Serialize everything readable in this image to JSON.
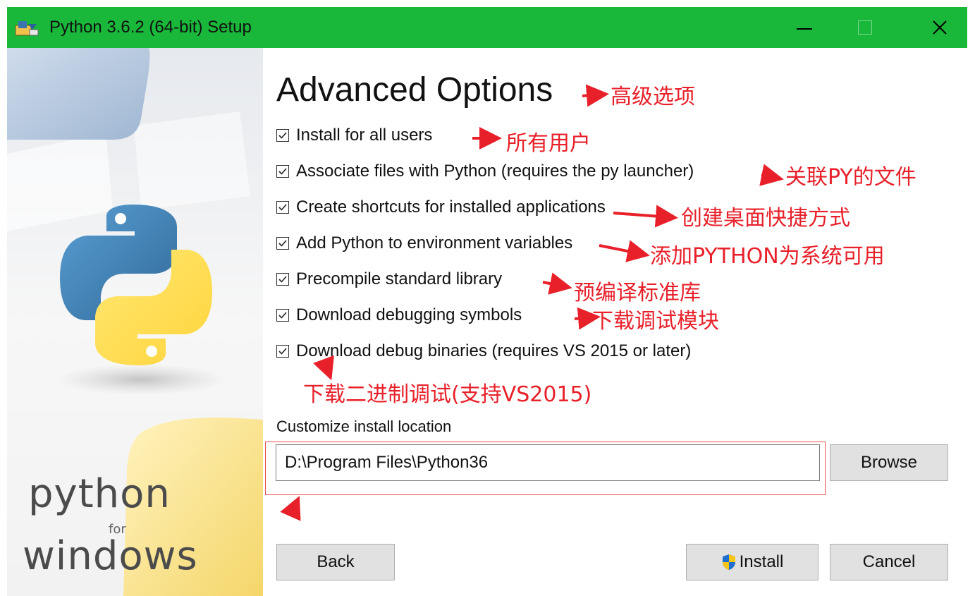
{
  "window": {
    "title": "Python 3.6.2 (64-bit) Setup",
    "app_icon": "python-setup-icon",
    "minimize_icon": "minimize-icon",
    "maximize_icon": "maximize-icon",
    "close_icon": "close-icon",
    "close_glyph": "✕",
    "titlebar_color": "#19b83a"
  },
  "left_panel": {
    "logo": "python-logo",
    "word_python": "python",
    "word_for": "for",
    "word_windows": "windows"
  },
  "main": {
    "heading": "Advanced Options",
    "options": [
      {
        "label": "Install for all users",
        "checked": true
      },
      {
        "label": "Associate files with Python (requires the py launcher)",
        "checked": true
      },
      {
        "label": "Create shortcuts for installed applications",
        "checked": true
      },
      {
        "label": "Add Python to environment variables",
        "checked": true
      },
      {
        "label": "Precompile standard library",
        "checked": true
      },
      {
        "label": "Download debugging symbols",
        "checked": true
      },
      {
        "label": "Download debug binaries (requires VS 2015 or later)",
        "checked": true
      }
    ],
    "location_label": "Customize install location",
    "location_value": "D:\\Program Files\\Python36",
    "browse_label": "Browse",
    "back_label": "Back",
    "install_label": "Install",
    "install_icon": "uac-shield-icon",
    "cancel_label": "Cancel"
  },
  "annotations": {
    "heading": "高级选项",
    "opt0": "所有用户",
    "opt1": "关联PY的文件",
    "opt2": "创建桌面快捷方式",
    "opt3": "添加PYTHON为系统可用",
    "opt4": "预编译标准库",
    "opt5": "下载调试模块",
    "opt6": "下载二进制调试(支持VS2015)",
    "color": "#e8202a"
  }
}
